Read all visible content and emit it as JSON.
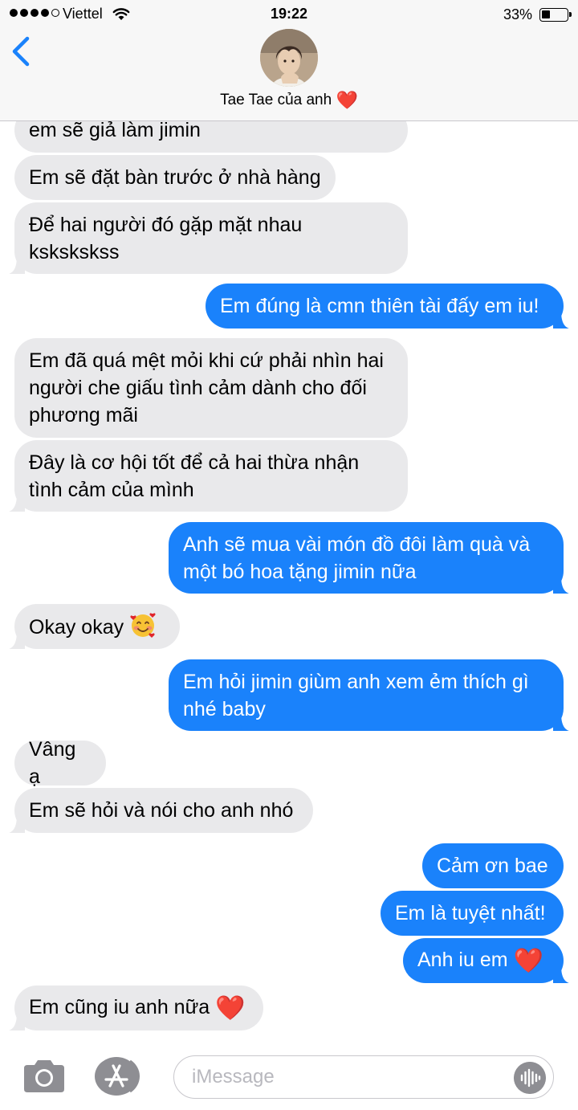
{
  "status_bar": {
    "carrier": "Viettel",
    "time": "19:22",
    "battery_percent": "33%",
    "battery_level": 0.33
  },
  "header": {
    "back_icon": "chevron-left-icon",
    "contact_name": "Tae Tae của anh",
    "name_emoji": "❤️"
  },
  "messages": [
    {
      "side": "in",
      "lines": [
        "em sẽ giả làm jimin"
      ]
    },
    {
      "side": "in",
      "lines": [
        "Em sẽ đặt bàn trước ở nhà hàng"
      ]
    },
    {
      "side": "in",
      "lines": [
        "Để hai người đó gặp mặt nhau",
        "kskskskss"
      ]
    },
    {
      "side": "out",
      "lines": [
        "Em đúng là cmn thiên tài đấy em iu!"
      ]
    },
    {
      "side": "in",
      "lines": [
        "Em đã quá mệt mỏi khi cứ phải nhìn hai",
        "người che giấu tình cảm dành cho đối",
        "phương mãi"
      ]
    },
    {
      "side": "in",
      "lines": [
        "Đây là cơ hội tốt để cả hai thừa nhận",
        "tình cảm của mình"
      ]
    },
    {
      "side": "out",
      "lines": [
        "Anh sẽ mua vài món đồ đôi làm quà và",
        "một bó hoa tặng jimin nữa"
      ]
    },
    {
      "side": "in",
      "lines": [
        "Okay okay"
      ],
      "emoji": "smiling-face-with-hearts"
    },
    {
      "side": "out",
      "lines": [
        "Em hỏi jimin giùm anh xem ẻm thích gì",
        "nhé baby"
      ]
    },
    {
      "side": "in",
      "lines": [
        "Vâng ạ"
      ]
    },
    {
      "side": "in",
      "lines": [
        "Em sẽ hỏi và nói cho anh nhó"
      ]
    },
    {
      "side": "out",
      "lines": [
        "Cảm ơn bae"
      ]
    },
    {
      "side": "out",
      "lines": [
        "Em là tuyệt nhất!"
      ]
    },
    {
      "side": "out",
      "lines": [
        "Anh iu em"
      ],
      "emoji": "❤️"
    },
    {
      "side": "in",
      "lines": [
        "Em cũng iu anh nữa"
      ],
      "emoji": "❤️"
    }
  ],
  "input_bar": {
    "placeholder": "iMessage",
    "camera_icon": "camera-icon",
    "apps_icon": "app-store-icon",
    "audio_icon": "audio-waveform-icon"
  },
  "colors": {
    "outgoing_bubble": "#1a82fb",
    "incoming_bubble": "#e9e9eb",
    "accent": "#1a82fb",
    "heart": "#e0252b"
  }
}
